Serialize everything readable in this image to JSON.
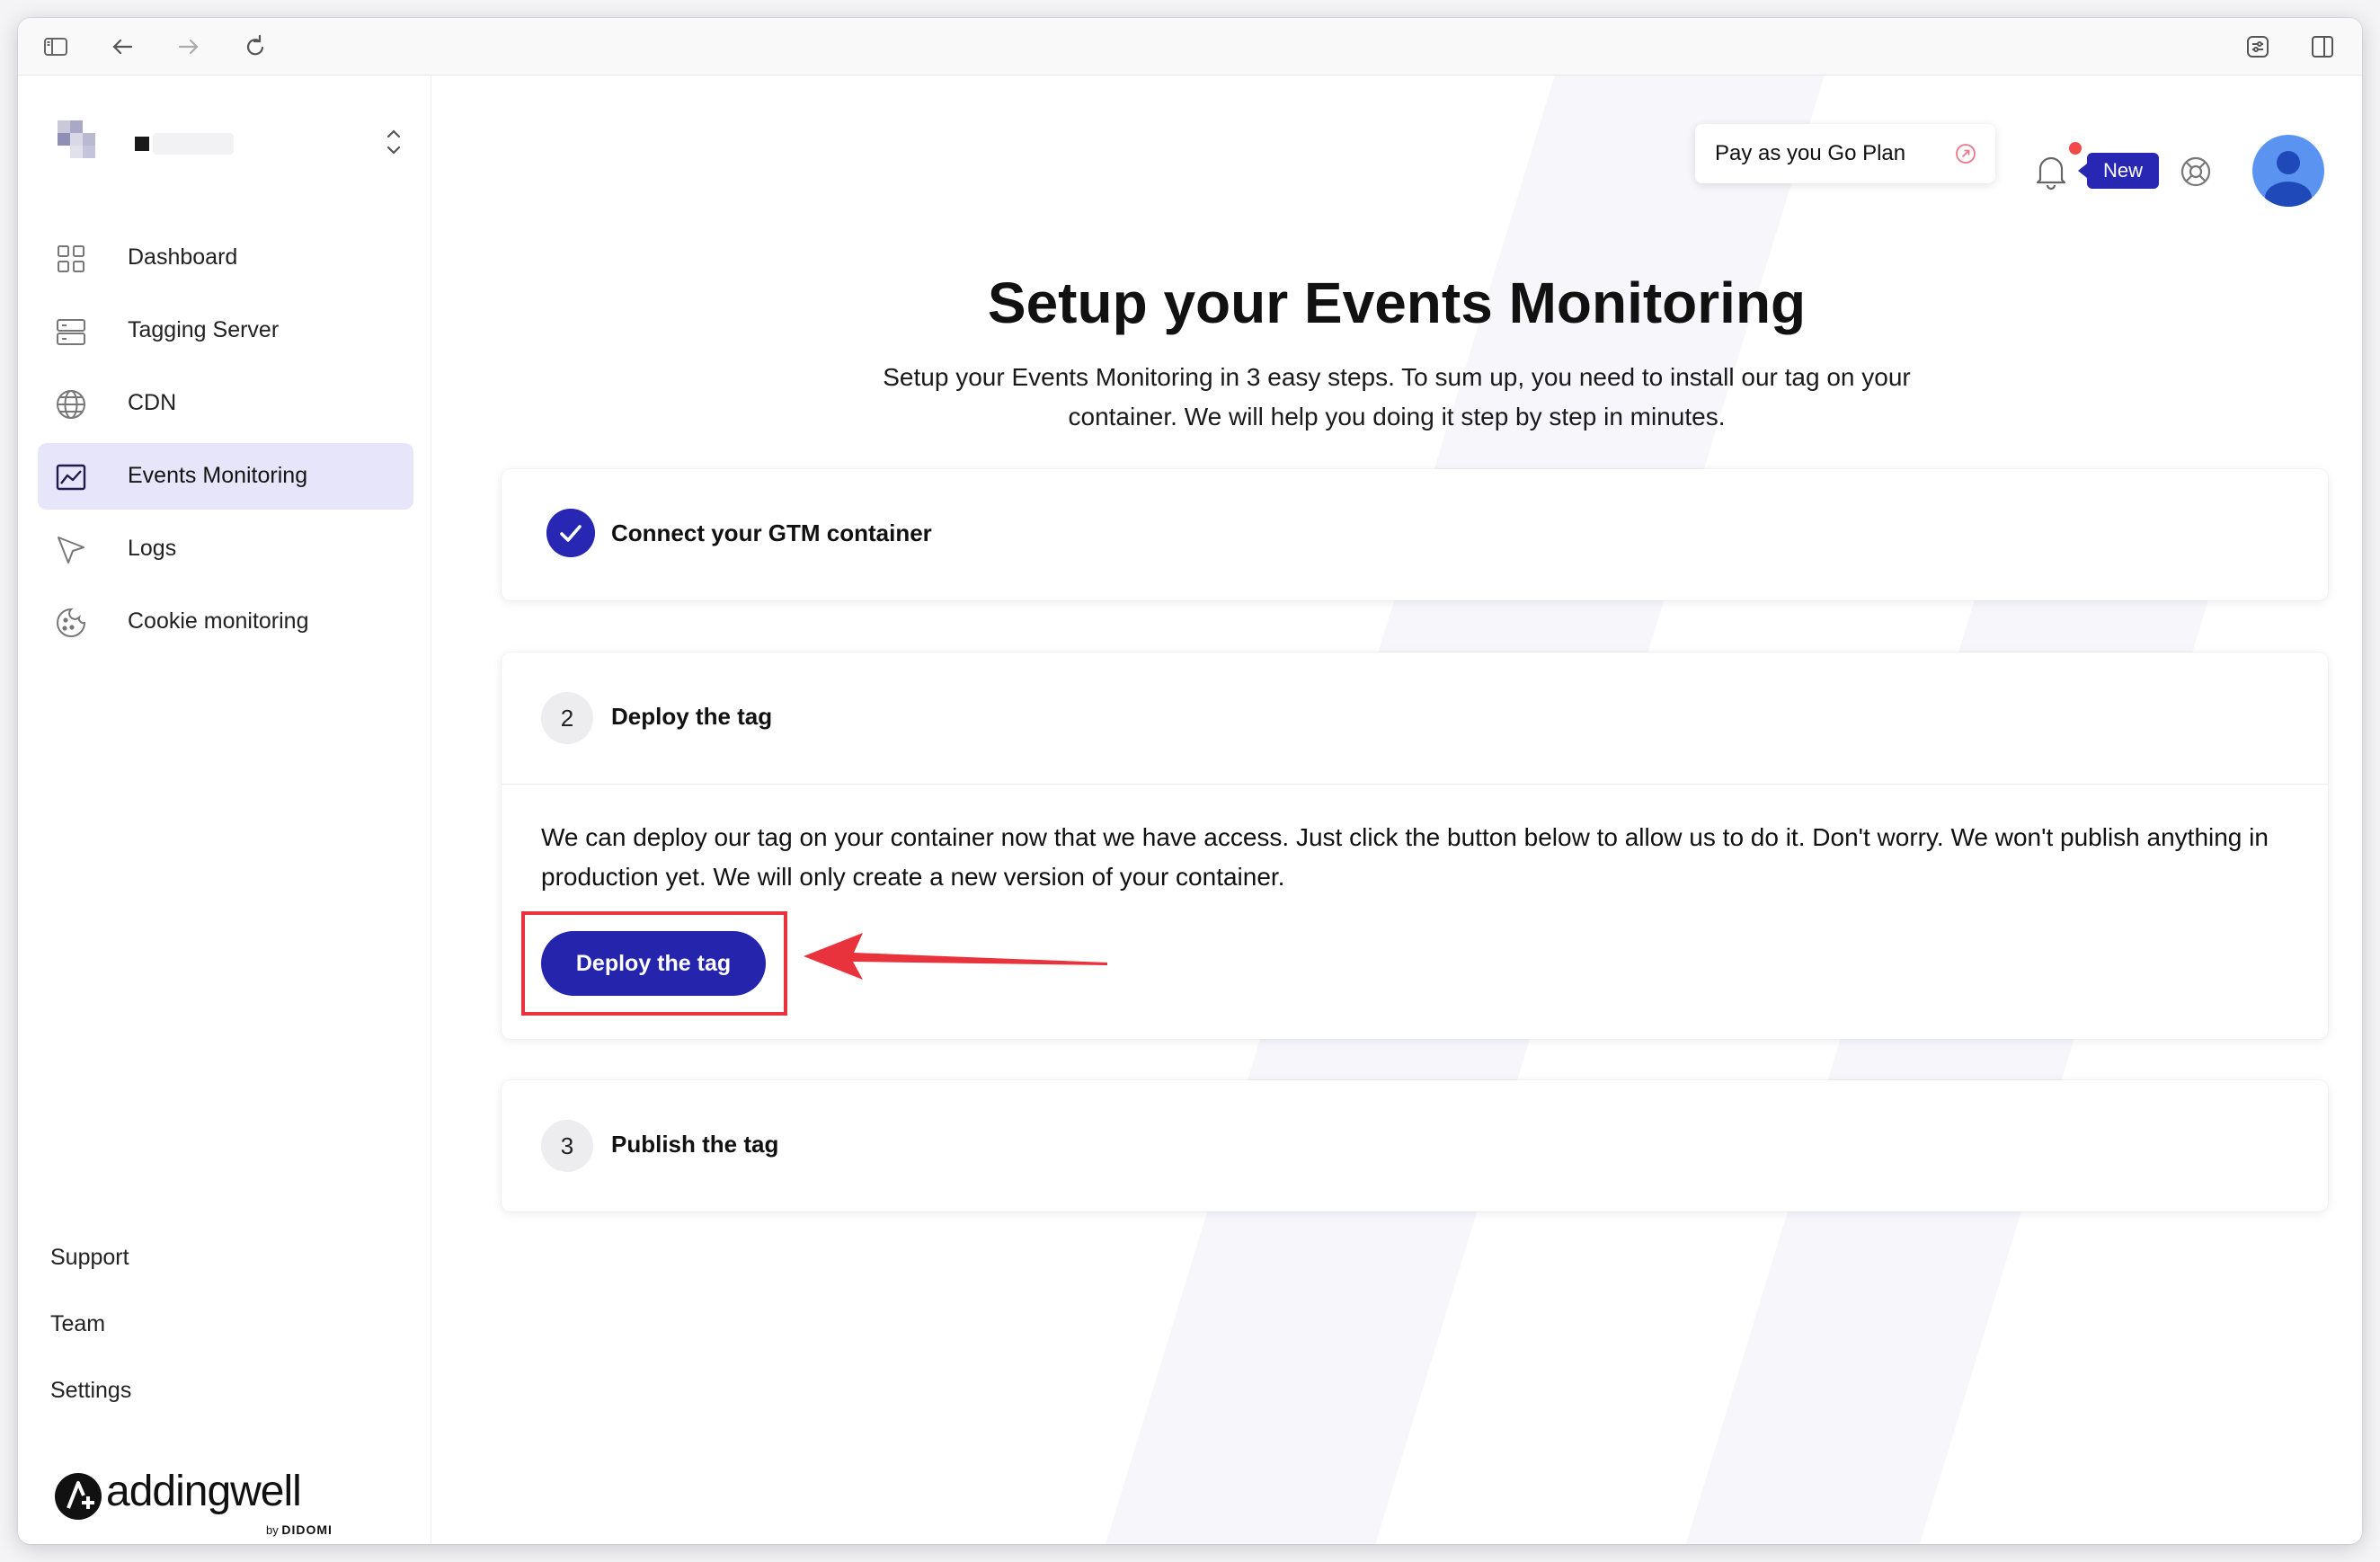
{
  "browser": {
    "icons": [
      "sidebar-toggle-icon",
      "back-arrow-icon",
      "forward-arrow-icon",
      "reload-icon",
      "extensions-icon",
      "split-view-icon"
    ]
  },
  "sidebar": {
    "items": [
      {
        "label": "Dashboard",
        "icon": "grid-icon"
      },
      {
        "label": "Tagging Server",
        "icon": "server-icon"
      },
      {
        "label": "CDN",
        "icon": "globe-icon"
      },
      {
        "label": "Events Monitoring",
        "icon": "chart-icon",
        "active": true
      },
      {
        "label": "Logs",
        "icon": "cursor-icon"
      },
      {
        "label": "Cookie monitoring",
        "icon": "cookie-icon"
      }
    ],
    "bottom": {
      "support": "Support",
      "team": "Team",
      "settings": "Settings"
    },
    "brand": {
      "name": "addingwell",
      "by": "by",
      "company": "DIDOMI"
    }
  },
  "header": {
    "plan_label": "Pay as you Go Plan",
    "new_badge": "New"
  },
  "page": {
    "title": "Setup your Events Monitoring",
    "subtitle": "Setup your Events Monitoring in 3 easy steps. To sum up, you need to install our tag on your container. We will help you doing it step by step in minutes."
  },
  "steps": [
    {
      "number": "1",
      "label": "Connect your GTM container",
      "status": "completed"
    },
    {
      "number": "2",
      "label": "Deploy the tag",
      "status": "active",
      "body": "We can deploy our tag on your container now that we have access. Just click the button below to allow us to do it. Don't worry. We won't publish anything in production yet. We will only create a new version of your container.",
      "button": "Deploy the tag"
    },
    {
      "number": "3",
      "label": "Publish the tag",
      "status": "pending"
    }
  ],
  "colors": {
    "accent": "#2424ad",
    "active_nav_bg": "#e6e5fa",
    "annotation": "#e8323c"
  }
}
